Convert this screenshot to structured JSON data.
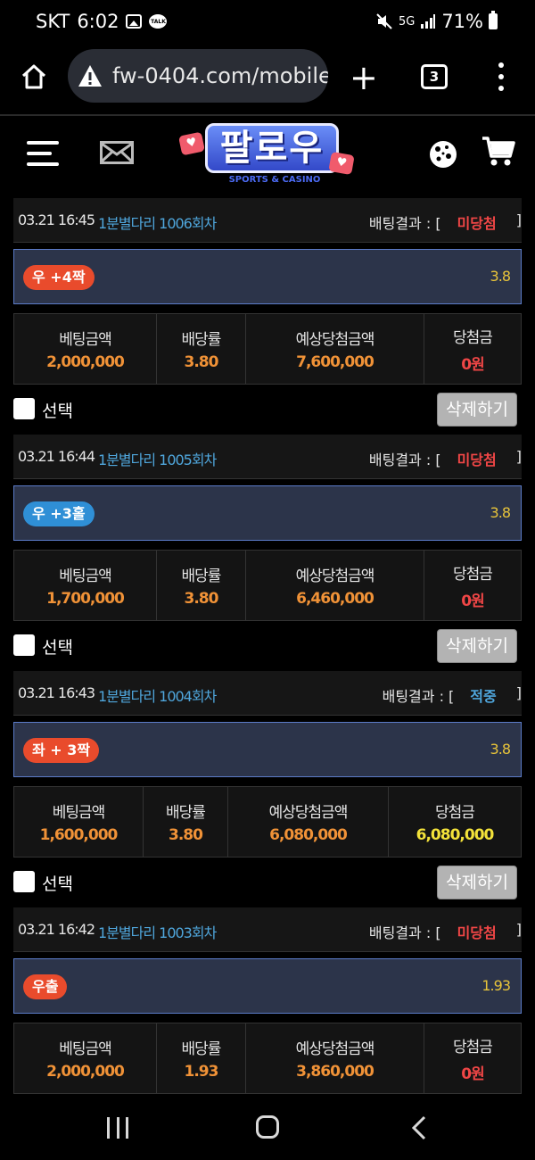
{
  "status_bar": {
    "carrier": "SKT",
    "time": "6:02",
    "talk_badge": "TALK",
    "network": "5G",
    "battery": "71%"
  },
  "browser": {
    "url": "fw-0404.com/mobile",
    "tab_count": "3",
    "plus_label": "+"
  },
  "site": {
    "logo_text": "팔로우",
    "logo_subtitle": "SPORTS & CASINO",
    "heart_glyph": "♥"
  },
  "labels": {
    "result_prefix": "배팅결과 : [",
    "result_suffix": "]",
    "bet_amount": "베팅금액",
    "odds": "배당률",
    "expected_win": "예상당첨금액",
    "win_amount": "당첨금",
    "select": "선택",
    "delete": "삭제하기"
  },
  "colors": {
    "red_badge": "#e94b2c",
    "blue_badge": "#2f8fd6",
    "status_red": "#f04646",
    "status_blue": "#4fa6dc"
  },
  "bets": [
    {
      "time": "03.21 16:45",
      "game": "1분별다리 1006회차",
      "status": "미당첨",
      "status_type": "lose",
      "pick": "우 +4짝",
      "pick_color": "red",
      "pick_odds": "3.8",
      "bet_amount": "2,000,000",
      "odds": "3.80",
      "expected": "7,600,000",
      "win": "0원",
      "win_type": "lose"
    },
    {
      "time": "03.21 16:44",
      "game": "1분별다리 1005회차",
      "status": "미당첨",
      "status_type": "lose",
      "pick": "우 +3홀",
      "pick_color": "blue",
      "pick_odds": "3.8",
      "bet_amount": "1,700,000",
      "odds": "3.80",
      "expected": "6,460,000",
      "win": "0원",
      "win_type": "lose"
    },
    {
      "time": "03.21 16:43",
      "game": "1분별다리 1004회차",
      "status": "적중",
      "status_type": "win",
      "pick": "좌 + 3짝",
      "pick_color": "red",
      "pick_odds": "3.8",
      "bet_amount": "1,600,000",
      "odds": "3.80",
      "expected": "6,080,000",
      "win": "6,080,000",
      "win_type": "win"
    },
    {
      "time": "03.21 16:42",
      "game": "1분별다리 1003회차",
      "status": "미당첨",
      "status_type": "lose",
      "pick": "우출",
      "pick_color": "red",
      "pick_odds": "1.93",
      "bet_amount": "2,000,000",
      "odds": "1.93",
      "expected": "3,860,000",
      "win": "0원",
      "win_type": "lose"
    }
  ]
}
